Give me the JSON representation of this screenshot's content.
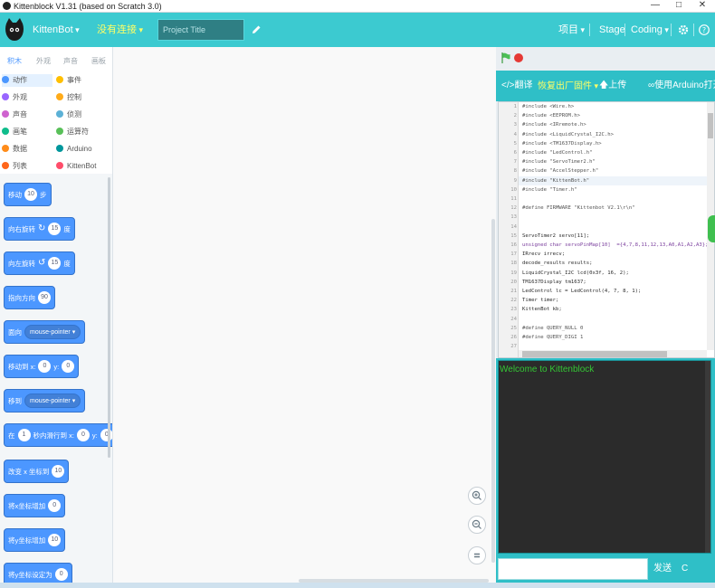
{
  "window": {
    "title": "Kittenblock V1.31 (based on Scratch 3.0)",
    "minimize": "—",
    "maximize": "□",
    "close": "✕"
  },
  "menubar": {
    "brand": "KittenBot",
    "connection": "没有连接",
    "project_title_placeholder": "Project Title",
    "project_menu": "项目",
    "stage": "Stage",
    "coding": "Coding",
    "settings_icon": "gear-icon",
    "help_icon": "help-icon",
    "bg_color": "#3ccad0",
    "connection_color": "#ffff66"
  },
  "category_tabs": [
    "积木",
    "外观",
    "声音",
    "画板"
  ],
  "categories": [
    {
      "label": "动作",
      "color": "#4c97ff"
    },
    {
      "label": "事件",
      "color": "#ffbf00"
    },
    {
      "label": "外观",
      "color": "#9966ff"
    },
    {
      "label": "控制",
      "color": "#ffab19"
    },
    {
      "label": "声音",
      "color": "#cf63cf"
    },
    {
      "label": "侦测",
      "color": "#5cb1d6"
    },
    {
      "label": "画笔",
      "color": "#0fbd8c"
    },
    {
      "label": "运算符",
      "color": "#59c059"
    },
    {
      "label": "数据",
      "color": "#ff8c1a"
    },
    {
      "label": "Arduino",
      "color": "#00979c"
    },
    {
      "label": "列表",
      "color": "#ff661a"
    },
    {
      "label": "KittenBot",
      "color": "#ff4d6a"
    }
  ],
  "blocks": {
    "move": {
      "label": "移动",
      "value": "10",
      "unit": "步"
    },
    "turn_right": {
      "label": "向右旋转",
      "value": "15",
      "unit": "度"
    },
    "turn_left": {
      "label": "向左旋转",
      "value": "15",
      "unit": "度"
    },
    "point_dir": {
      "label": "指向方向",
      "value": "90"
    },
    "point_towards": {
      "label": "面向",
      "option": "mouse-pointer"
    },
    "goto_xy": {
      "label": "移动到 x:",
      "x": "0",
      "ylabel": "y:",
      "y": "0"
    },
    "goto": {
      "label": "移到",
      "option": "mouse-pointer"
    },
    "glide": {
      "label": "在",
      "secs": "1",
      "mid": "秒内滑行到 x:",
      "x": "0",
      "ylabel": "y:",
      "y": "0"
    },
    "change_x": {
      "label": "改变 x 坐标到",
      "value": "10"
    },
    "set_x": {
      "label": "将x坐标增加",
      "value": "0"
    },
    "change_y": {
      "label": "将y坐标增加",
      "value": "10"
    },
    "set_y": {
      "label": "将y坐标设定为",
      "value": "0"
    }
  },
  "codebar": {
    "translate": "</>翻译",
    "restore_firmware": "恢复出厂固件",
    "upload": "上传",
    "open_arduino": "∞使用Arduino打开"
  },
  "code_lines": [
    "#include <Wire.h>",
    "#include <EEPROM.h>",
    "#include <IRremote.h>",
    "#include <LiquidCrystal_I2C.h>",
    "#include <TM1637Display.h>",
    "#include \"LedControl.h\"",
    "#include \"ServoTimer2.h\"",
    "#include \"AccelStepper.h\"",
    "#include \"KittenBot.h\"",
    "#include \"Timer.h\"",
    "",
    "#define FIRMWARE \"Kittenbot V2.1\\r\\n\"",
    "",
    "",
    "ServoTimer2 servo[11];",
    "unsigned char servoPinMap[10]  ={4,7,8,11,12,13,A0,A1,A2,A3};",
    "IRrecv irrecv;",
    "decode_results results;",
    "LiquidCrystal_I2C lcd(0x3f, 16, 2);",
    "TM1637Display tm1637;",
    "LedControl lc = LedControl(4, 7, 8, 1);",
    "Timer timer;",
    "KittenBot kb;",
    "",
    "#define QUERY_NULL 0",
    "#define QUERY_DIGI 1",
    ""
  ],
  "line_numbers": [
    "1",
    "2",
    "3",
    "4",
    "5",
    "6",
    "7",
    "8",
    "9",
    "10",
    "11",
    "12",
    "13",
    "14",
    "15",
    "16",
    "17",
    "18",
    "19",
    "20",
    "21",
    "22",
    "23",
    "24",
    "25",
    "26",
    "27"
  ],
  "console": {
    "welcome": "Welcome to Kittenblock"
  },
  "send_row": {
    "send": "发送",
    "clear": "C"
  }
}
